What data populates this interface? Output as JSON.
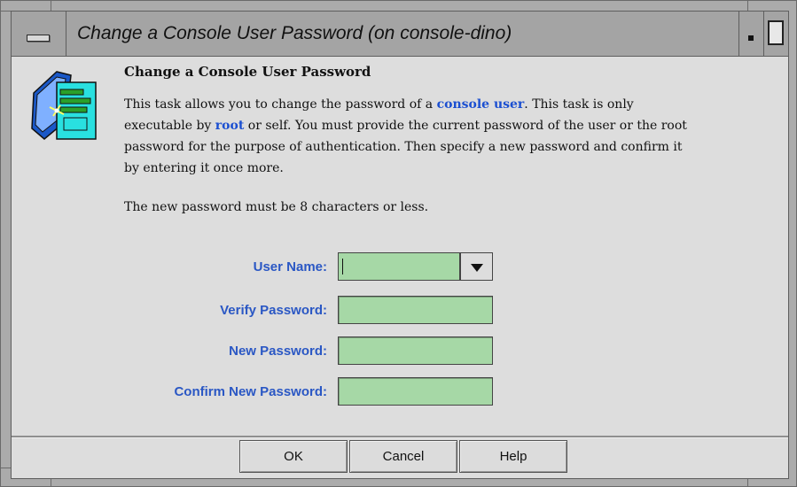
{
  "window": {
    "title": "Change a Console User Password (on console-dino)"
  },
  "task": {
    "heading": "Change a Console User Password",
    "description": {
      "l1_pre": "This task allows you to change the password of a ",
      "l1_link": "console user",
      "l1_post": ".  This task is only",
      "l2_pre": "executable by ",
      "l2_link": "root",
      "l2_post": " or self.  You must provide the current password of the user or the root",
      "l3": "password for the purpose of authentication. Then specify a new password and confirm it",
      "l4": "by entering it once more."
    },
    "note": "The new password must be 8 characters or less."
  },
  "form": {
    "user_name_label": "User Name:",
    "user_name_value": "",
    "verify_password_label": "Verify Password:",
    "new_password_label": "New Password:",
    "confirm_password_label": "Confirm New Password:"
  },
  "buttons": {
    "ok": "OK",
    "cancel": "Cancel",
    "help": "Help"
  },
  "colors": {
    "field_bg": "#a6d8a6",
    "label_blue": "#2a57c4",
    "link_blue": "#1b4fd1",
    "dialog_bg": "#dddddd"
  },
  "icons": {
    "window_menu": "window-menu-icon",
    "minimize": "minimize-icon",
    "maximize": "maximize-icon",
    "task": "task-document-icon",
    "dropdown": "chevron-down-icon"
  }
}
